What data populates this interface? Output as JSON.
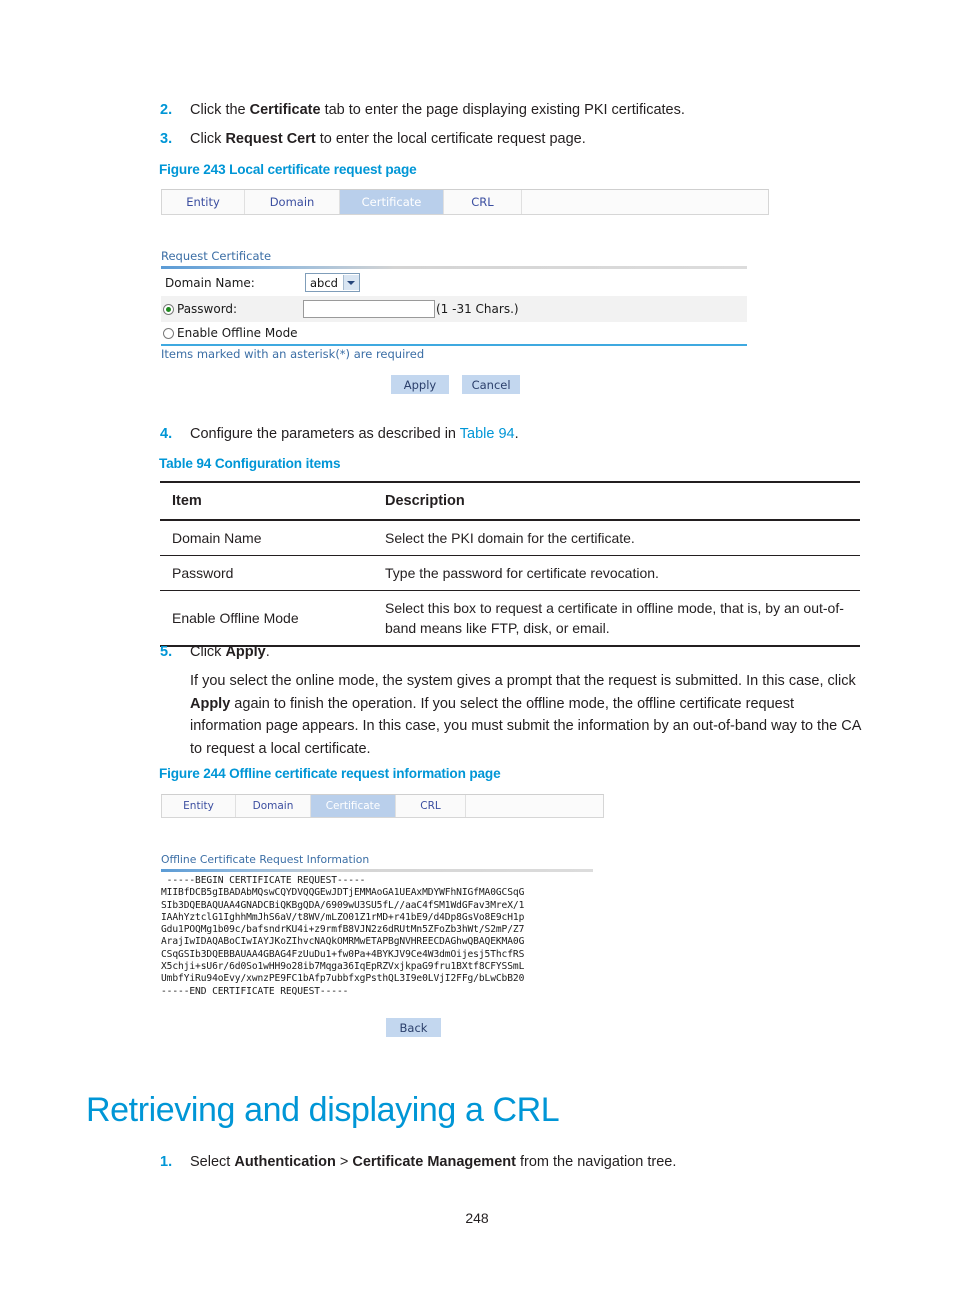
{
  "steps": {
    "step2": {
      "num": "2.",
      "text_pre": "Click the ",
      "bold1": "Certificate",
      "text_post": " tab to enter the page displaying existing PKI certificates."
    },
    "step3": {
      "num": "3.",
      "text_pre": "Click ",
      "bold1": "Request Cert",
      "text_post": " to enter the local certificate request page."
    },
    "step4": {
      "num": "4.",
      "text_pre": "Configure the parameters as described in ",
      "link": "Table 94",
      "text_post": "."
    },
    "step5": {
      "num": "5.",
      "text_pre": "Click ",
      "bold1": "Apply",
      "text_post": "."
    },
    "step5_para": {
      "p1": "If you select the online mode, the system gives a prompt that the request is submitted. In this case, click ",
      "b1": "Apply",
      "p2": " again to finish the operation. If you select the offline mode, the offline certificate request information page appears. In this case, you must submit the information by an out-of-band way to the CA to request a local certificate."
    },
    "step_crl_1": {
      "num": "1.",
      "text_pre": "Select ",
      "bold1": "Authentication",
      "mid": " > ",
      "bold2": "Certificate Management",
      "text_post": " from the navigation tree."
    }
  },
  "captions": {
    "figure243": "Figure 243 Local certificate request page",
    "table94": "Table 94 Configuration items",
    "figure244": "Figure 244 Offline certificate request information page"
  },
  "heading": {
    "crl": "Retrieving and displaying a CRL"
  },
  "figure243": {
    "tabs": [
      {
        "label": "Entity",
        "active": false
      },
      {
        "label": "Domain",
        "active": false
      },
      {
        "label": "Certificate",
        "active": true
      },
      {
        "label": "CRL",
        "active": false
      }
    ],
    "section_title": "Request Certificate",
    "domain_label": "Domain Name:",
    "domain_value": "abcd",
    "password_label": "Password:",
    "password_value": "",
    "password_hint": "(1 -31 Chars.)",
    "offline_label": "Enable Offline Mode",
    "required_note": "Items marked with an asterisk(*) are required",
    "apply_label": "Apply",
    "cancel_label": "Cancel"
  },
  "figure244": {
    "tabs": [
      {
        "label": "Entity",
        "active": false
      },
      {
        "label": "Domain",
        "active": false
      },
      {
        "label": "Certificate",
        "active": true
      },
      {
        "label": "CRL",
        "active": false
      }
    ],
    "section_title": "Offline Certificate Request Information",
    "cert_text": " -----BEGIN CERTIFICATE REQUEST-----\nMIIBfDCB5gIBADAbMQswCQYDVQQGEwJDTjEMMAoGA1UEAxMDYWFhNIGfMA0GCSqG\nSIb3DQEBAQUAA4GNADCBiQKBgQDA/6909wU3SU5fL//aaC4fSM1WdGFav3MreX/1\nIAAhYztclG1IghhMmJhS6aV/t8WV/mLZO01Z1rMD+r41bE9/d4Dp8GsVo8E9cH1p\nGdu1POQMg1b09c/bafsndrKU4i+z9rmfB8VJN2z6dRUtMn5ZFoZb3hWt/S2mP/Z7\nArajIwIDAQABoCIwIAYJKoZIhvcNAQkOMRMwETAPBgNVHREECDAGhwQBAQEKMA0G\nCSqGSIb3DQEBBAUAA4GBAG4FzUuDu1+fw0Pa+4BYKJV9Ce4W3dmOijesj5ThcfRS\nX5chji+sU6r/6d0So1wHH9o28ib7Mqga36IqEpRZVxjkpaG9fru1BXtf8CFYSSmL\nUmbfYiRu94oEvy/xwnzPE9FC1bAfp7ubbfxgPsthQL3I9e0LVjI2FFg/bLwCbB20\n-----END CERTIFICATE REQUEST-----",
    "back_label": "Back"
  },
  "table94": {
    "headers": [
      "Item",
      "Description"
    ],
    "rows": [
      {
        "item": "Domain Name",
        "description": "Select the PKI domain for the certificate."
      },
      {
        "item": "Password",
        "description": "Type the password for certificate revocation."
      },
      {
        "item": "Enable Offline Mode",
        "description": "Select this box to request a certificate in offline mode, that is, by an out-of-band means like FTP, disk, or email."
      }
    ]
  },
  "footer": {
    "page_number": "248"
  },
  "colors": {
    "accent": "#0096d6",
    "tab_active_bg": "#b9cfeb",
    "button_bg": "#c3d7ef",
    "radio_on": "#1f8a1f"
  }
}
